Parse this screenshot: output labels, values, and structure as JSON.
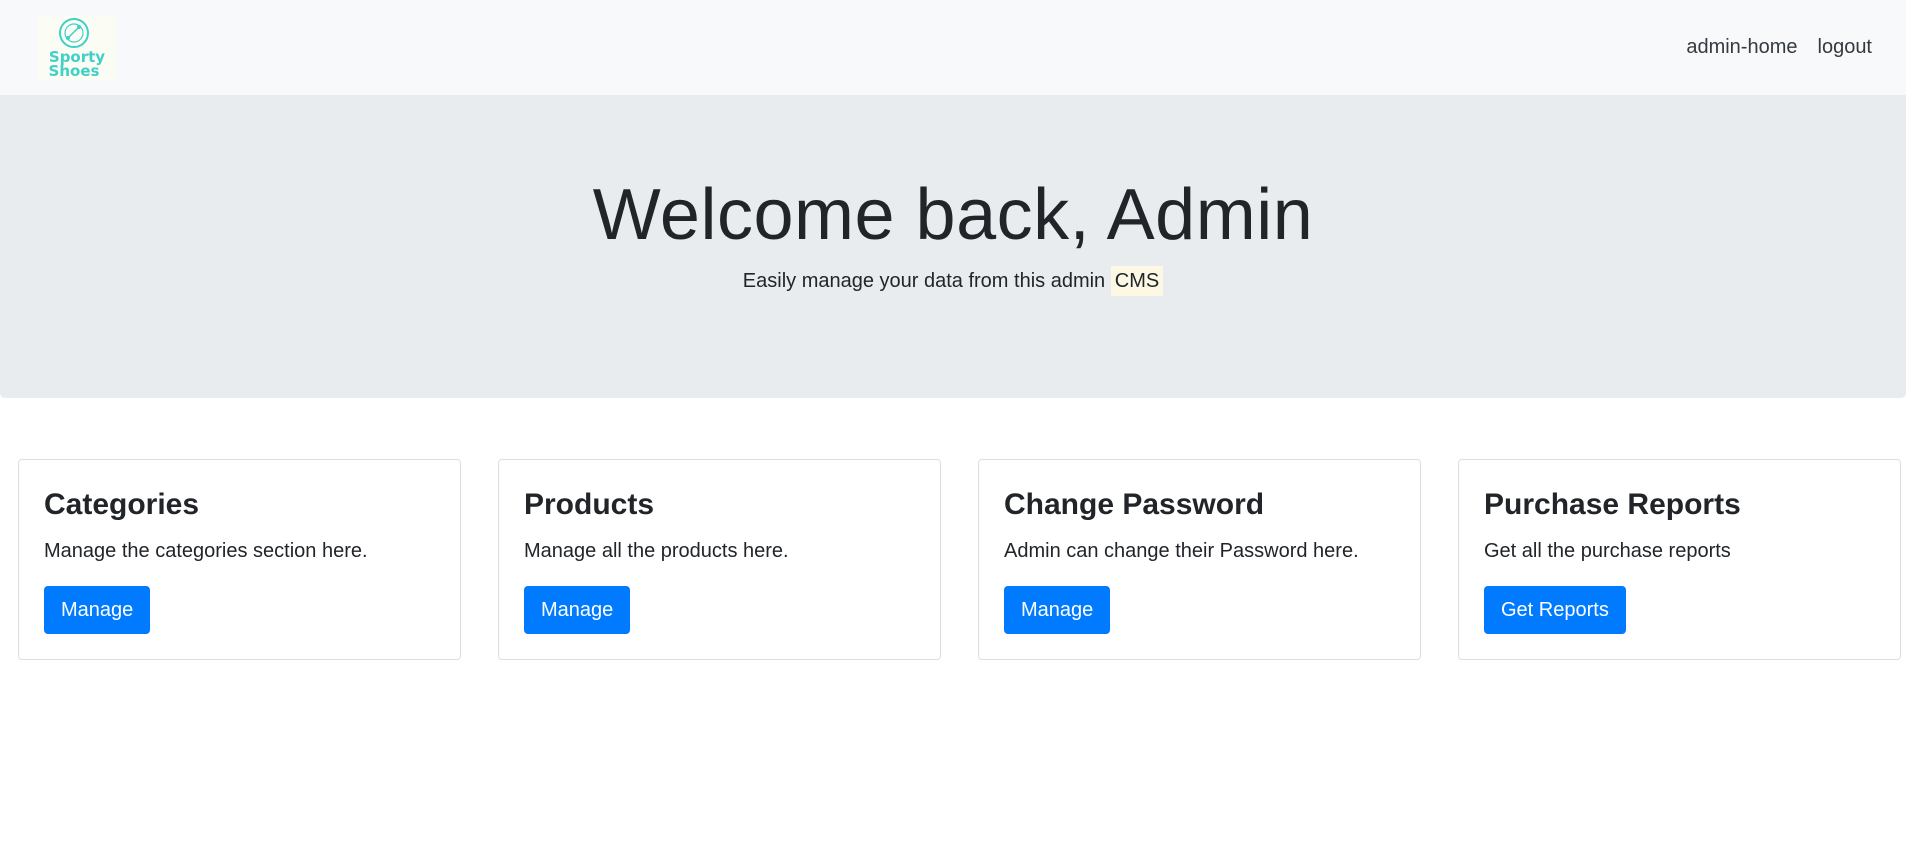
{
  "nav": {
    "brand_name": "Sporty Shoes",
    "links": [
      "admin-home",
      "logout"
    ]
  },
  "hero": {
    "title": "Welcome back, Admin",
    "subtitle_text": "Easily manage your data from this admin",
    "subtitle_mark": "CMS"
  },
  "cards": [
    {
      "title": "Categories",
      "text": "Manage the categories section here.",
      "button": "Manage"
    },
    {
      "title": "Products",
      "text": "Manage all the products here.",
      "button": "Manage"
    },
    {
      "title": "Change Password",
      "text": "Admin can change their Password here.",
      "button": "Manage"
    },
    {
      "title": "Purchase Reports",
      "text": "Get all the purchase reports",
      "button": "Get Reports"
    }
  ],
  "colors": {
    "primary": "#007bff",
    "navbar_bg": "#f8f9fa",
    "jumbotron_bg": "#e9ecef",
    "logo_teal": "#3fd0c9"
  },
  "icons": {
    "logo": "sporty-shoes-logo-icon"
  }
}
